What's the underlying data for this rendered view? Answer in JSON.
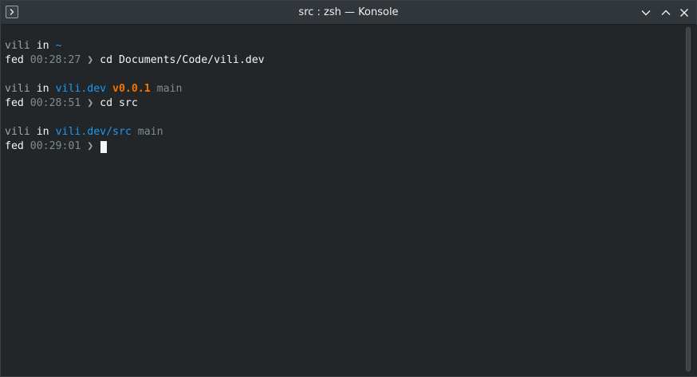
{
  "window": {
    "title": "src : zsh — Konsole"
  },
  "icons": {
    "app": "terminal-prompt-icon",
    "minimize": "chevron-down-icon",
    "maximize": "chevron-up-icon",
    "close": "close-icon"
  },
  "colors": {
    "background": "#232629",
    "directory": "#1d99f3",
    "version": "#f67400",
    "dim": "#7f8c8d"
  },
  "terminal": {
    "prompts": [
      {
        "user": "vili",
        "in": "in",
        "dir": "~",
        "host": "fed",
        "time": "00:28:27",
        "arrow": "❯",
        "command": "cd Documents/Code/vili.dev"
      },
      {
        "user": "vili",
        "in": "in",
        "dir": "vili.dev",
        "version": "v0.0.1",
        "branch": "main",
        "host": "fed",
        "time": "00:28:51",
        "arrow": "❯",
        "command": "cd src"
      },
      {
        "user": "vili",
        "in": "in",
        "dir": "vili.dev/src",
        "branch": "main",
        "host": "fed",
        "time": "00:29:01",
        "arrow": "❯",
        "command": ""
      }
    ]
  }
}
